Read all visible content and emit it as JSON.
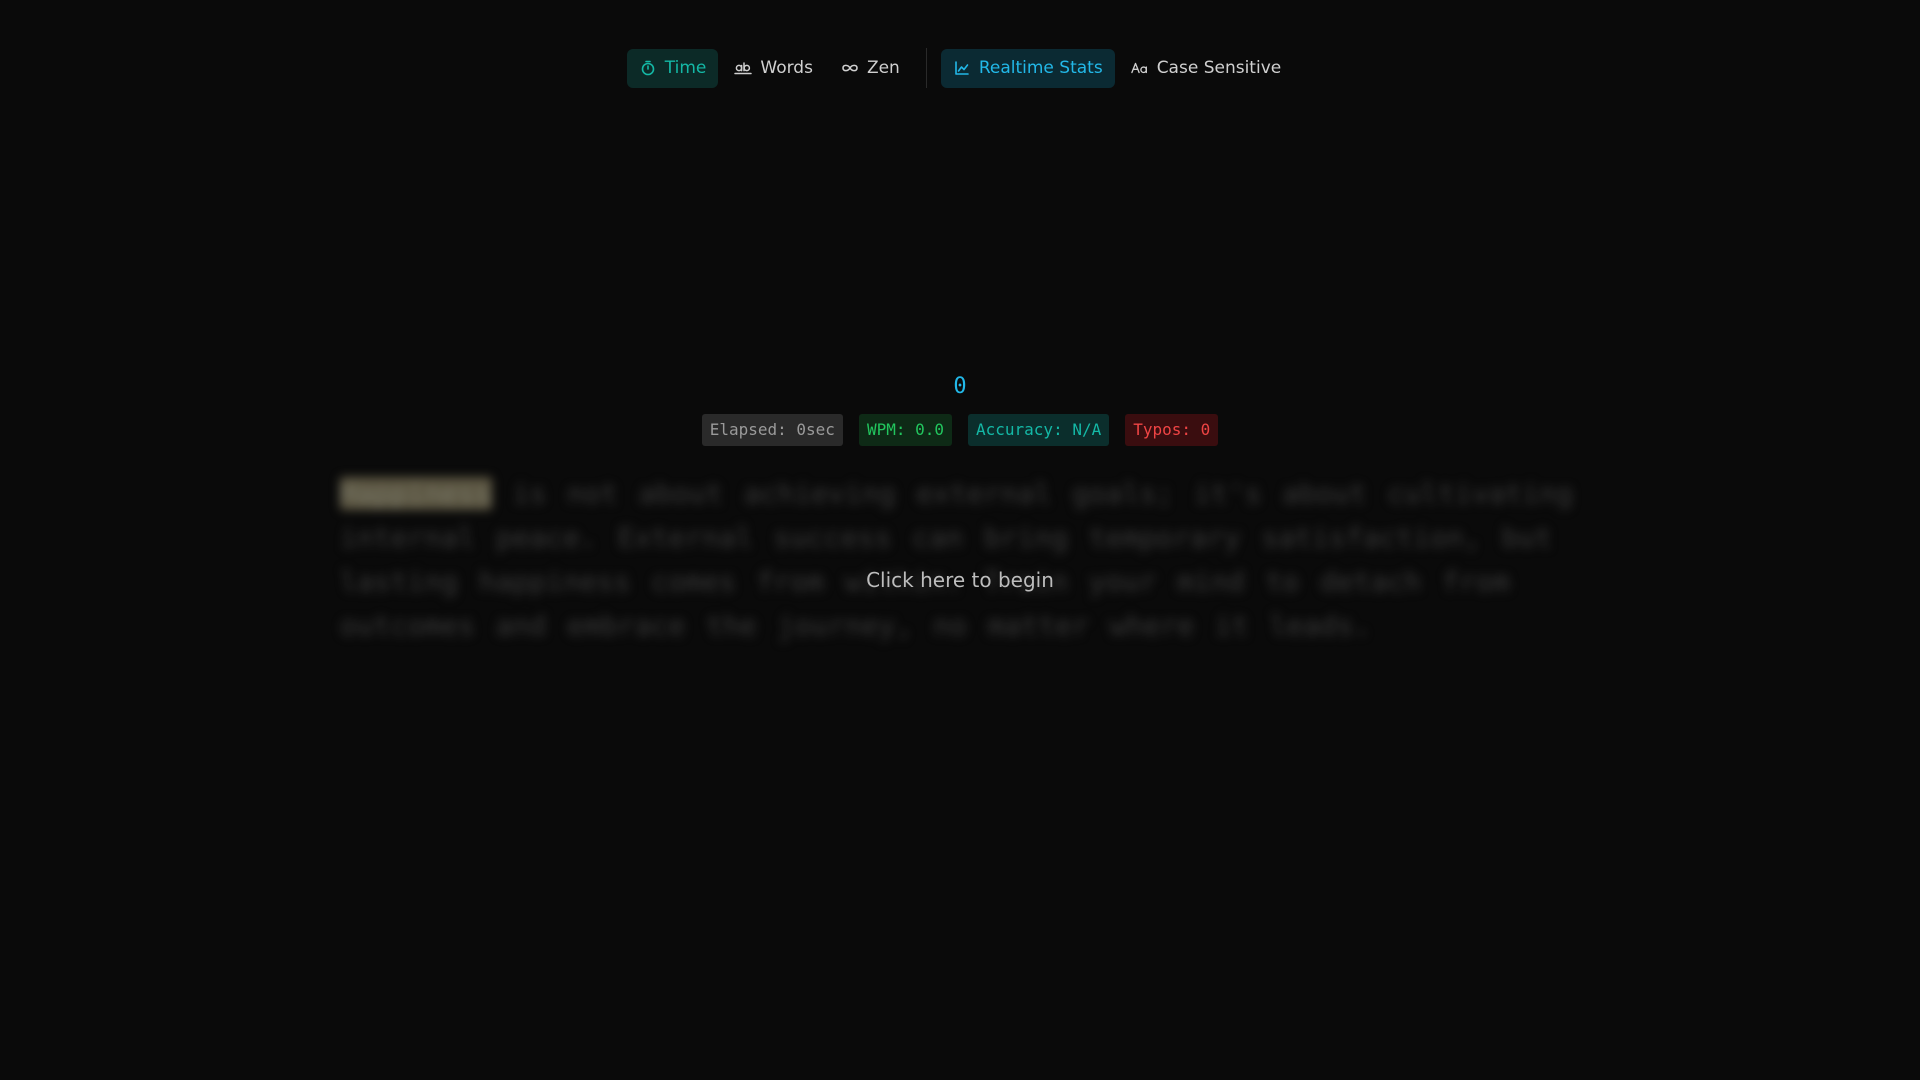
{
  "toolbar": {
    "modes": [
      {
        "label": "Time",
        "icon": "stopwatch-icon"
      },
      {
        "label": "Words",
        "icon": "ab-icon"
      },
      {
        "label": "Zen",
        "icon": "infinity-icon"
      }
    ],
    "options": [
      {
        "label": "Realtime Stats",
        "icon": "chart-icon"
      },
      {
        "label": "Case Sensitive",
        "icon": "case-icon"
      }
    ]
  },
  "timer": {
    "value": "0"
  },
  "stats": {
    "elapsed": "Elapsed: 0sec",
    "wpm": "WPM: 0.0",
    "accuracy": "Accuracy: N/A",
    "typos": "Typos: 0"
  },
  "passage": {
    "first_word": "Happiness",
    "rest": " is not about achieving external goals; it's about cultivating internal peace. External success can bring temporary satisfaction, but lasting happiness comes from within. Train your mind to detach from outcomes and embrace the journey, no matter where it leads."
  },
  "prompt": {
    "begin": "Click here to begin"
  },
  "colors": {
    "background": "#0a0a0a",
    "teal": "#14b8a6",
    "cyan": "#22b8e8",
    "green": "#22c55e",
    "red": "#ef4444"
  }
}
